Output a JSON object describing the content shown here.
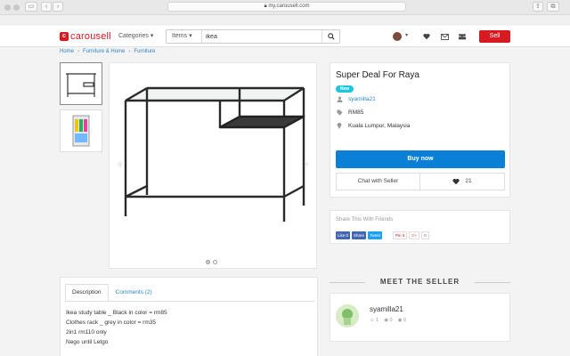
{
  "browser": {
    "url": "my.carousell.com"
  },
  "header": {
    "logo": "carousell",
    "categories_label": "Categories",
    "search_type": "Items",
    "search_value": "ikea",
    "sell_label": "Sell"
  },
  "breadcrumb": [
    "Home",
    "Furniture & Home",
    "Furniture"
  ],
  "listing": {
    "title": "Super Deal For Raya",
    "badge": "New",
    "seller": "syamilla21",
    "price": "RM85",
    "location": "Kuala Lumpur, Malaysia",
    "buy_label": "Buy now",
    "chat_label": "Chat with Seller",
    "likes": "21"
  },
  "share": {
    "title": "Share This With Friends",
    "fb_like": "Like 0",
    "fb_share": "Share",
    "tweet": "Tweet",
    "pin": "Pin it",
    "gplus": "G+",
    "gplus_count": "0"
  },
  "description": {
    "tab_description": "Description",
    "tab_comments": "Comments (2)",
    "lines": [
      "Ikea study table _ Black in color = rm85",
      "Clothes rack _ grey in color = rm35",
      "2in1 rm110 only",
      "Nego until Letgo"
    ]
  },
  "meet_seller": {
    "title": "MEET THE SELLER",
    "name": "syamilla21",
    "positive": "1",
    "neutral": "0",
    "negative": "0"
  },
  "colors": {
    "brand": "#d71a21",
    "buy": "#0a7fd6",
    "link": "#2b86c9",
    "badge": "#1dc6e0"
  }
}
